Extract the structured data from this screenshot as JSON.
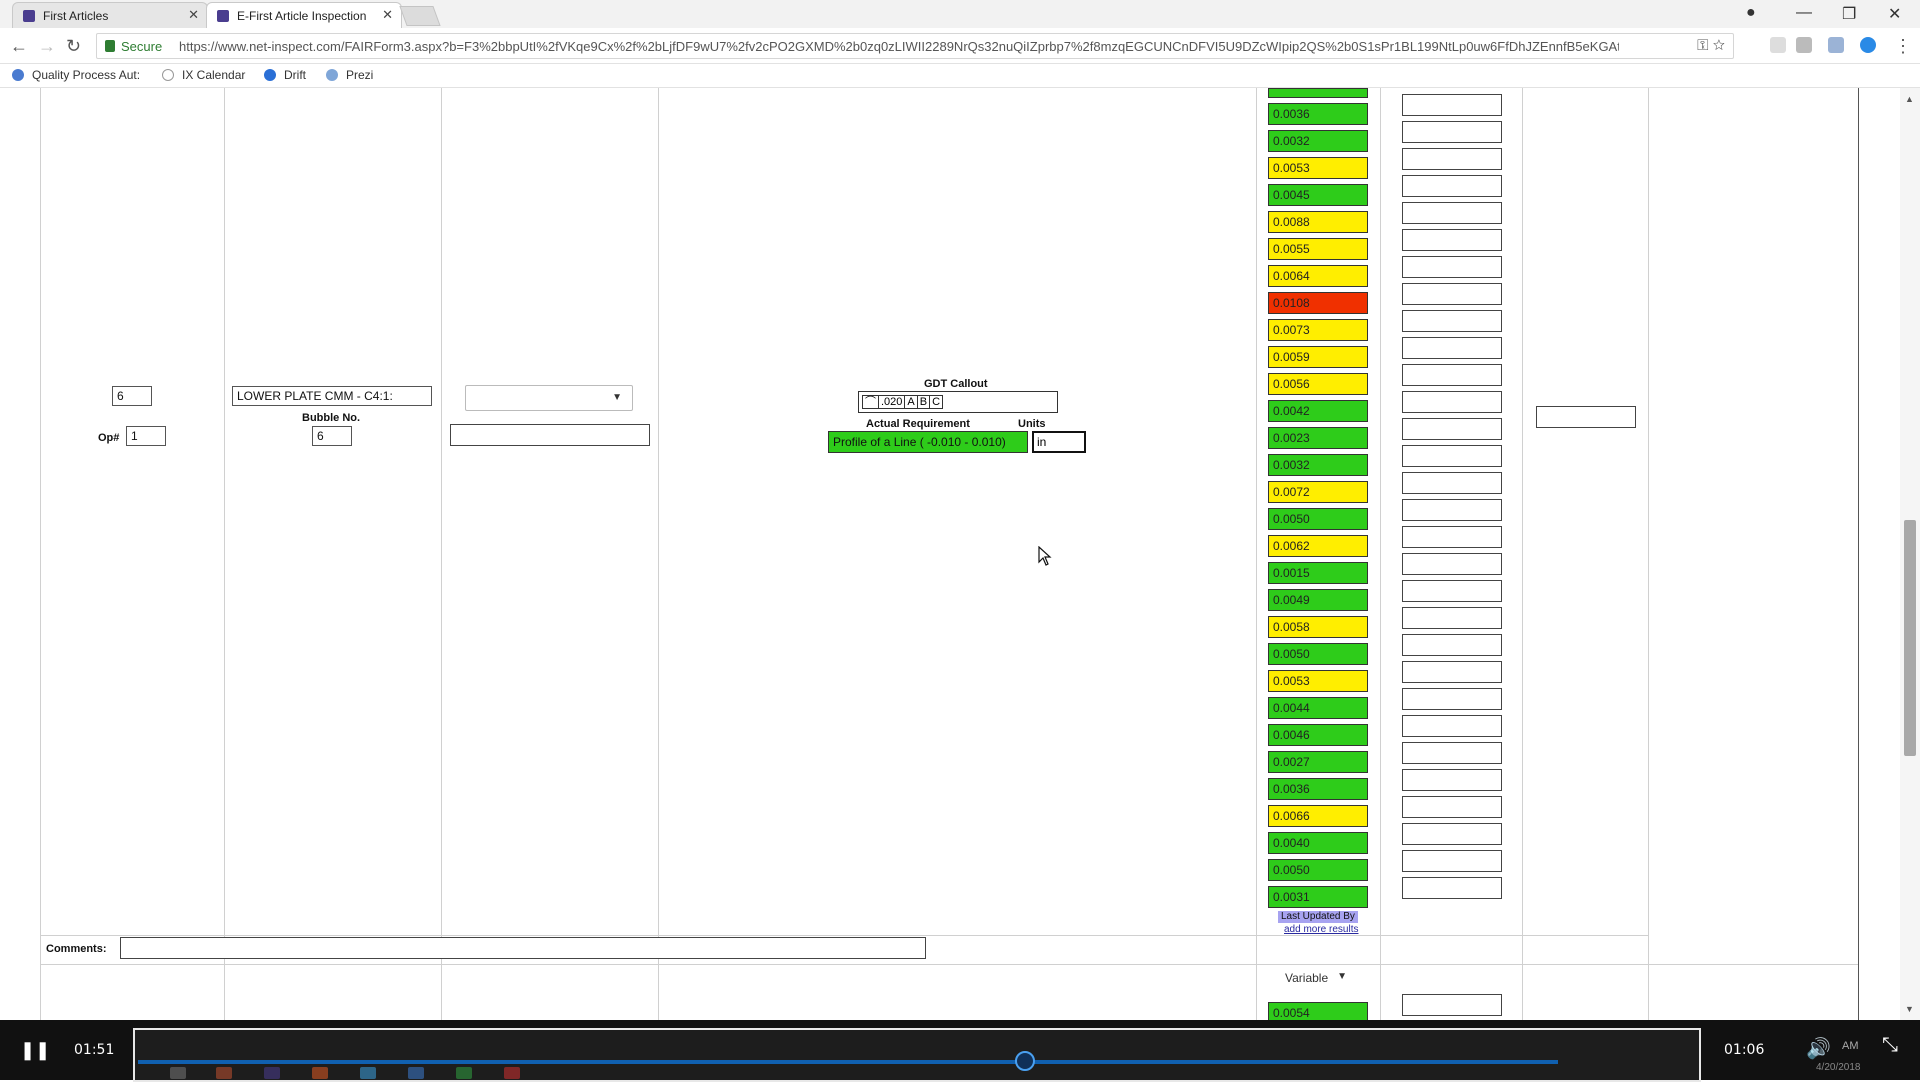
{
  "browser": {
    "tabs": [
      {
        "label": "First Articles",
        "active": false
      },
      {
        "label": "E-First Article Inspection",
        "active": true
      }
    ],
    "url": "https://www.net-inspect.com/FAIRForm3.aspx?b=F3%2bbpUtI%2fVKqe9Cx%2f%2bLjfDF9wU7%2fv2cPO2GXMD%2b0zq0zLIWII2289NrQs32nuQiIZprbp7%2f8mzqEGCUNCnDFVI5U9DZcWIpip2QS%2b0S1sPr1BL199NtLp0uw6FfDhJZEnnfB5eKGAtee...",
    "secure_label": "Secure",
    "bookmarks": [
      "Quality Process Aut:",
      "IX Calendar",
      "Drift",
      "Prezi"
    ]
  },
  "form": {
    "balloon_no": "6",
    "op_label": "Op#",
    "op_value": "1",
    "characteristic": "LOWER PLATE CMM - C4:1:",
    "bubble_label": "Bubble No.",
    "bubble_value": "6",
    "gdt_label": "GDT Callout",
    "gdt_symbol": "profile-of-a-line-icon",
    "gdt_frame": [
      ".020",
      "A",
      "B",
      "C"
    ],
    "actual_req_label": "Actual Requirement",
    "units_label": "Units",
    "requirement": "Profile of a Line ( -0.010 - 0.010)",
    "units_value": "in",
    "comments_label": "Comments:",
    "results": [
      {
        "value": "0.0036",
        "status": "green"
      },
      {
        "value": "0.0032",
        "status": "green"
      },
      {
        "value": "0.0053",
        "status": "yellow"
      },
      {
        "value": "0.0045",
        "status": "green"
      },
      {
        "value": "0.0088",
        "status": "yellow"
      },
      {
        "value": "0.0055",
        "status": "yellow"
      },
      {
        "value": "0.0064",
        "status": "yellow"
      },
      {
        "value": "0.0108",
        "status": "red"
      },
      {
        "value": "0.0073",
        "status": "yellow"
      },
      {
        "value": "0.0059",
        "status": "yellow"
      },
      {
        "value": "0.0056",
        "status": "yellow"
      },
      {
        "value": "0.0042",
        "status": "green"
      },
      {
        "value": "0.0023",
        "status": "green"
      },
      {
        "value": "0.0032",
        "status": "green"
      },
      {
        "value": "0.0072",
        "status": "yellow"
      },
      {
        "value": "0.0050",
        "status": "green"
      },
      {
        "value": "0.0062",
        "status": "yellow"
      },
      {
        "value": "0.0015",
        "status": "green"
      },
      {
        "value": "0.0049",
        "status": "green"
      },
      {
        "value": "0.0058",
        "status": "yellow"
      },
      {
        "value": "0.0050",
        "status": "green"
      },
      {
        "value": "0.0053",
        "status": "yellow"
      },
      {
        "value": "0.0044",
        "status": "green"
      },
      {
        "value": "0.0046",
        "status": "green"
      },
      {
        "value": "0.0027",
        "status": "green"
      },
      {
        "value": "0.0036",
        "status": "green"
      },
      {
        "value": "0.0066",
        "status": "yellow"
      },
      {
        "value": "0.0040",
        "status": "green"
      },
      {
        "value": "0.0050",
        "status": "green"
      },
      {
        "value": "0.0031",
        "status": "green"
      }
    ],
    "last_updated_label": "Last Updated By",
    "add_more_label": "add more results",
    "next_row_type": "Variable",
    "next_row_first_result": "0.0054",
    "status_colors": {
      "green": "#2ecc1a",
      "yellow": "#ffee00",
      "red": "#f03000"
    }
  },
  "player": {
    "elapsed": "01:51",
    "remaining": "01:06",
    "progress": 0.62,
    "clock": "AM",
    "date": "4/20/2018"
  }
}
